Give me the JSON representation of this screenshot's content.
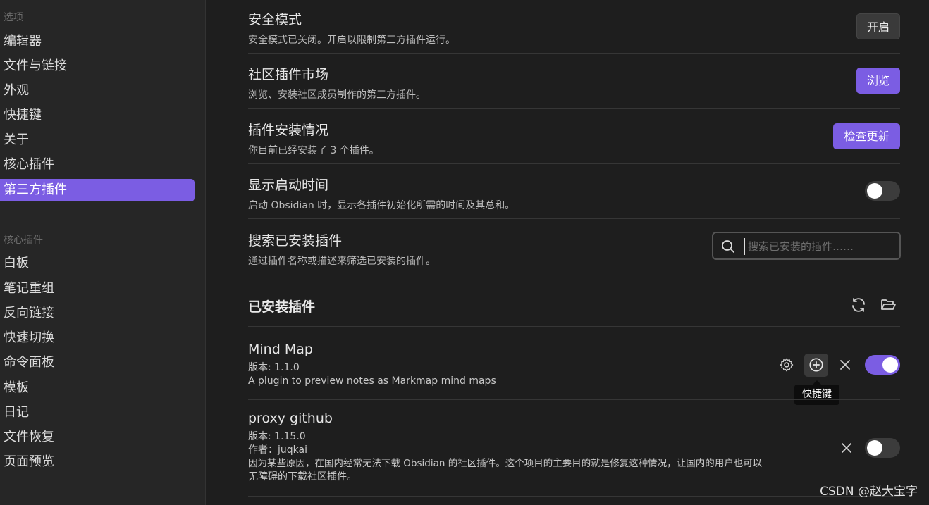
{
  "sidebar": {
    "options_heading": "选项",
    "options": [
      {
        "label": "编辑器"
      },
      {
        "label": "文件与链接"
      },
      {
        "label": "外观"
      },
      {
        "label": "快捷键"
      },
      {
        "label": "关于"
      },
      {
        "label": "核心插件"
      },
      {
        "label": "第三方插件",
        "active": true
      }
    ],
    "core_heading": "核心插件",
    "core": [
      {
        "label": "白板"
      },
      {
        "label": "笔记重组"
      },
      {
        "label": "反向链接"
      },
      {
        "label": "快速切换"
      },
      {
        "label": "命令面板"
      },
      {
        "label": "模板"
      },
      {
        "label": "日记"
      },
      {
        "label": "文件恢复"
      },
      {
        "label": "页面预览"
      }
    ]
  },
  "settings": {
    "safe_mode": {
      "title": "安全模式",
      "desc": "安全模式已关闭。开启以限制第三方插件运行。",
      "button": "开启"
    },
    "community": {
      "title": "社区插件市场",
      "desc": "浏览、安装社区成员制作的第三方插件。",
      "button": "浏览"
    },
    "installed_status": {
      "title": "插件安装情况",
      "desc": "你目前已经安装了 3 个插件。",
      "button": "检查更新"
    },
    "startup_time": {
      "title": "显示启动时间",
      "desc": "启动 Obsidian 时，显示各插件初始化所需的时间及其总和。",
      "enabled": false
    },
    "search": {
      "title": "搜索已安装插件",
      "desc": "通过插件名称或描述来筛选已安装的插件。",
      "placeholder": "搜索已安装的插件……"
    }
  },
  "installed": {
    "heading": "已安装插件",
    "plugins": [
      {
        "name": "Mind Map",
        "version": "版本: 1.1.0",
        "description": "A plugin to preview notes as Markmap mind maps",
        "enabled": true
      },
      {
        "name": "proxy github",
        "version": "版本: 1.15.0",
        "author": "作者：juqkai",
        "description_line1": "因为某些原因，在国内经常无法下载 Obsidian 的社区插件。这个项目的主要目的就是修复这种情况，让国内的用户也可以",
        "description_line2": "无障碍的下载社区插件。",
        "enabled": false
      }
    ]
  },
  "tooltip": "快捷键",
  "watermark": "CSDN @赵大宝字",
  "colors": {
    "accent": "#7b5de3",
    "background": "#1e1e1e",
    "sidebar": "#262626"
  }
}
